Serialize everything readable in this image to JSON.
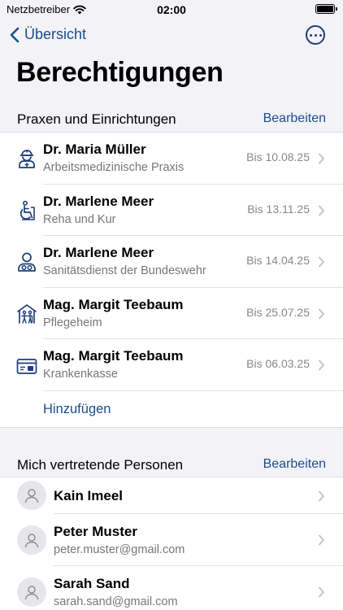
{
  "status": {
    "carrier": "Netzbetreiber",
    "time": "02:00",
    "battery_level": 1.0
  },
  "nav": {
    "back_label": "Übersicht"
  },
  "page_title": "Berechtigungen",
  "practices": {
    "header": "Praxen und Einrichtungen",
    "edit_label": "Bearbeiten",
    "items": [
      {
        "name": "Dr. Maria Müller",
        "type": "Arbeitsmedizinische Praxis",
        "valid_until": "Bis 10.08.25",
        "icon": "occupational-medicine-icon"
      },
      {
        "name": "Dr. Marlene Meer",
        "type": "Reha und Kur",
        "valid_until": "Bis 13.11.25",
        "icon": "rehabilitation-icon"
      },
      {
        "name": "Dr. Marlene Meer",
        "type": "Sanitätsdienst der Bundeswehr",
        "valid_until": "Bis 14.04.25",
        "icon": "military-medical-icon"
      },
      {
        "name": "Mag. Margit Teebaum",
        "type": "Pflegeheim",
        "valid_until": "Bis 25.07.25",
        "icon": "nursing-home-icon"
      },
      {
        "name": "Mag. Margit Teebaum",
        "type": "Krankenkasse",
        "valid_until": "Bis 06.03.25",
        "icon": "health-insurance-card-icon"
      }
    ],
    "add_label": "Hinzufügen"
  },
  "representatives": {
    "header": "Mich vertretende Personen",
    "edit_label": "Bearbeiten",
    "items": [
      {
        "name": "Kain Imeel",
        "email": ""
      },
      {
        "name": "Peter Muster",
        "email": "peter.muster@gmail.com"
      },
      {
        "name": "Sarah Sand",
        "email": "sarah.sand@gmail.com"
      }
    ]
  },
  "colors": {
    "accent": "#1c4d8c",
    "background": "#f2f2f7",
    "secondary_text": "#777777"
  }
}
